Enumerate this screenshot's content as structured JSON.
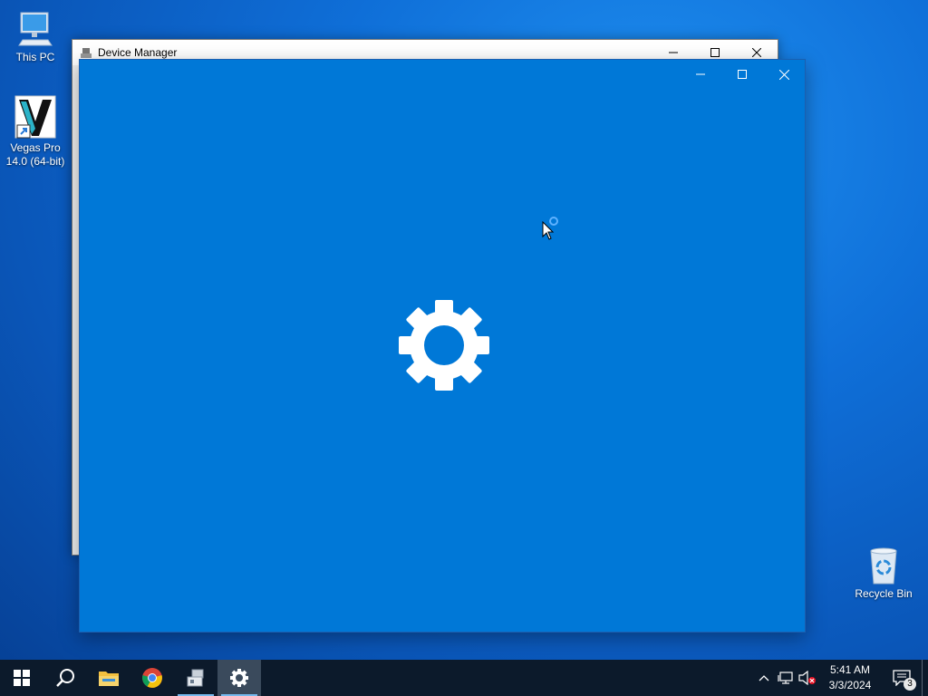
{
  "desktop": {
    "icons": [
      {
        "label": "This PC"
      },
      {
        "label": "Vegas Pro\n14.0 (64-bit)"
      },
      {
        "label": "Recycle Bin"
      }
    ]
  },
  "device_manager": {
    "title": "Device Manager"
  },
  "settings_window": {
    "icon": "gear-icon",
    "accent": "#0078d7"
  },
  "taskbar": {
    "pinned": [
      "start-icon",
      "search-icon",
      "chrome-icon",
      "file-explorer-icon",
      "device-manager-icon",
      "settings-icon"
    ],
    "clock": {
      "time": "5:41 AM",
      "date": "3/3/2024"
    },
    "notifications_count": "3"
  },
  "colors": {
    "taskbar": "#0c1a2b",
    "settings_bg": "#0078d7"
  }
}
